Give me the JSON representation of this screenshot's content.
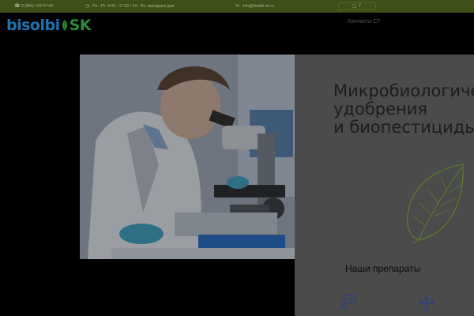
{
  "topbar": {
    "phone": "8 (904) 700-47-00",
    "hours": "Пн - Пт: 9:00 - 17:00 / Сб - Вс: выходные дни",
    "email": "info@bisolbi-sk.ru"
  },
  "header": {
    "logo_part1": "bisolbi",
    "logo_part2": "SK",
    "nav_link": "Контакты СТ"
  },
  "hero": {
    "title_lines": [
      "Микробиологические",
      "удобрения",
      "и биопестициды"
    ]
  },
  "products": {
    "title": "Наши препараты"
  },
  "colors": {
    "topbar": "#3e4f17",
    "logo_blue": "#1f73b0",
    "logo_green": "#2e8a3a",
    "leaf": "#6e8a33"
  }
}
